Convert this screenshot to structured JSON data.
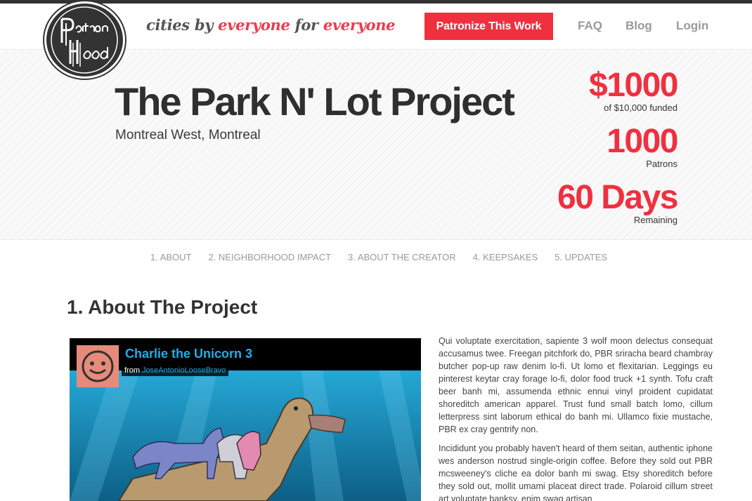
{
  "header": {
    "logo_text": "Patron Hood",
    "tagline": {
      "part1": "cities by ",
      "highlight1": "everyone",
      "part2": " for ",
      "highlight2": "everyone"
    },
    "cta_label": "Patronize This Work",
    "nav": [
      {
        "label": "FAQ"
      },
      {
        "label": "Blog"
      },
      {
        "label": "Login"
      }
    ]
  },
  "project": {
    "title": "The Park N' Lot Project",
    "location": "Montreal West, Montreal"
  },
  "stats": [
    {
      "value": "$1000",
      "caption": "of $10,000 funded"
    },
    {
      "value": "1000",
      "caption": "Patrons"
    },
    {
      "value": "60 Days",
      "caption": "Remaining"
    }
  ],
  "tabs": [
    {
      "label": "1. ABOUT"
    },
    {
      "label": "2. NEIGHBORHOOD IMPACT"
    },
    {
      "label": "3. ABOUT THE CREATOR"
    },
    {
      "label": "4. KEEPSAKES"
    },
    {
      "label": "5. UPDATES"
    }
  ],
  "section": {
    "title": "1. About The Project"
  },
  "video": {
    "title": "Charlie the Unicorn 3",
    "from_prefix": "from ",
    "author": "JoseAntonioLooseBravo"
  },
  "body": {
    "paragraphs": [
      "Qui voluptate exercitation, sapiente 3 wolf moon delectus consequat accusamus twee. Freegan pitchfork do, PBR sriracha beard chambray butcher pop-up raw denim lo-fi. Ut lomo et flexitarian. Leggings eu pinterest keytar cray forage lo-fi, dolor food truck +1 synth. Tofu craft beer banh mi, assumenda ethnic ennui vinyl proident cupidatat shoreditch american apparel. Trust fund small batch lomo, cillum letterpress sint laborum ethical do banh mi. Ullamco fixie mustache, PBR ex cray gentrify non.",
      "Incididunt you probably haven't heard of them seitan, authentic iphone wes anderson nostrud single-origin coffee. Before they sold out PBR mcsweeney's cliche ea dolor banh mi swag. Etsy shoreditch before they sold out, mollit umami placeat direct trade. Polaroid cillum street art voluptate banksy, enim swag artisan"
    ]
  },
  "colors": {
    "accent": "#f0303f",
    "dark": "#333333",
    "muted": "#9a9a9a",
    "link_blue": "#1eaee8"
  }
}
